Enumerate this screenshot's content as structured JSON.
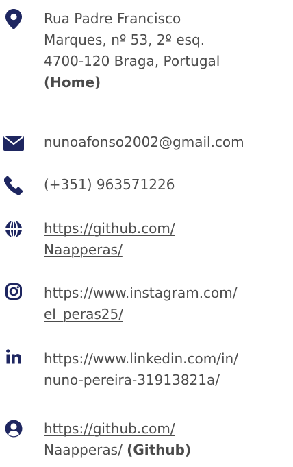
{
  "contacts": {
    "address": {
      "icon": "map-marker-icon",
      "lines": [
        "Rua Padre Francisco",
        "Marques, nº 53, 2º esq.",
        "4700-120 Braga, Portugal"
      ],
      "tag": "(Home)"
    },
    "email": {
      "icon": "envelope-icon",
      "value": "nunoafonso2002@gmail.com"
    },
    "phone": {
      "icon": "phone-icon",
      "value": "(+351) 963571226"
    },
    "website": {
      "icon": "globe-icon",
      "lines": [
        "https://github.com/",
        "Naapperas/"
      ]
    },
    "instagram": {
      "icon": "instagram-icon",
      "lines": [
        "https://www.instagram.com/",
        "el_peras25/"
      ]
    },
    "linkedin": {
      "icon": "linkedin-icon",
      "lines": [
        "https://www.linkedin.com/in/",
        "nuno-pereira-31913821a/"
      ]
    },
    "github": {
      "icon": "user-circle-icon",
      "lines": [
        "https://github.com/",
        "Naapperas/"
      ],
      "tag": "(Github)"
    }
  },
  "colors": {
    "icon": "#1e2660",
    "text": "#4d4d4d"
  }
}
